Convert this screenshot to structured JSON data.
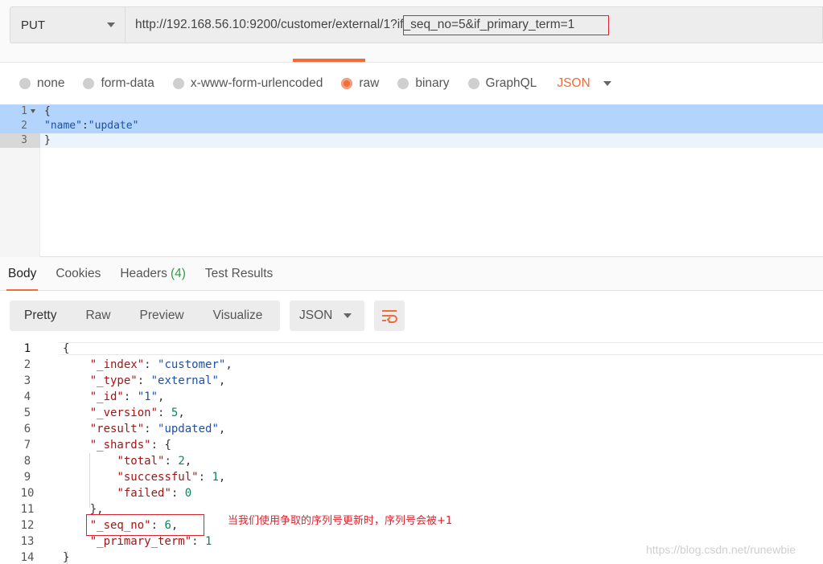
{
  "request": {
    "method": "PUT",
    "url": "http://192.168.56.10:9200/customer/external/1?if_seq_no=5&if_primary_term=1"
  },
  "body_types": {
    "options": [
      "none",
      "form-data",
      "x-www-form-urlencoded",
      "raw",
      "binary",
      "GraphQL"
    ],
    "selected": "raw",
    "format": "JSON"
  },
  "request_body": {
    "lines": [
      {
        "num": "1",
        "text": "{"
      },
      {
        "num": "2",
        "key": "\"name\"",
        "sep": ":",
        "value": "\"update\""
      },
      {
        "num": "3",
        "text": "}"
      }
    ]
  },
  "response_tabs": {
    "body": "Body",
    "cookies": "Cookies",
    "headers": "Headers",
    "headers_count": "(4)",
    "test_results": "Test Results"
  },
  "response_toolbar": {
    "modes": [
      "Pretty",
      "Raw",
      "Preview",
      "Visualize"
    ],
    "format": "JSON"
  },
  "response_body": {
    "lines": [
      {
        "num": "1",
        "code": "{"
      },
      {
        "num": "2",
        "key": "\"_index\"",
        "val": "\"customer\"",
        "kind": "str",
        "trail": ","
      },
      {
        "num": "3",
        "key": "\"_type\"",
        "val": "\"external\"",
        "kind": "str",
        "trail": ","
      },
      {
        "num": "4",
        "key": "\"_id\"",
        "val": "\"1\"",
        "kind": "str",
        "trail": ","
      },
      {
        "num": "5",
        "key": "\"_version\"",
        "val": "5",
        "kind": "num",
        "trail": ","
      },
      {
        "num": "6",
        "key": "\"result\"",
        "val": "\"updated\"",
        "kind": "str",
        "trail": ","
      },
      {
        "num": "7",
        "key": "\"_shards\"",
        "val": "{",
        "kind": "plain",
        "trail": ""
      },
      {
        "num": "8",
        "key": "\"total\"",
        "val": "2",
        "kind": "num",
        "trail": ",",
        "deep": true
      },
      {
        "num": "9",
        "key": "\"successful\"",
        "val": "1",
        "kind": "num",
        "trail": ",",
        "deep": true
      },
      {
        "num": "10",
        "key": "\"failed\"",
        "val": "0",
        "kind": "num",
        "trail": "",
        "deep": true
      },
      {
        "num": "11",
        "code": "    },"
      },
      {
        "num": "12",
        "key": "\"_seq_no\"",
        "val": "6",
        "kind": "num",
        "trail": ","
      },
      {
        "num": "13",
        "key": "\"_primary_term\"",
        "val": "1",
        "kind": "num",
        "trail": ""
      },
      {
        "num": "14",
        "code": "}"
      }
    ]
  },
  "annotation": "当我们使用争取的序列号更新时，序列号会被+1",
  "watermark": "https://blog.csdn.net/runewbie",
  "colors": {
    "accent": "#f26b3a",
    "highlight_box": "#d9232e",
    "string": "#1d50a8",
    "key": "#a31515",
    "number": "#098658"
  }
}
